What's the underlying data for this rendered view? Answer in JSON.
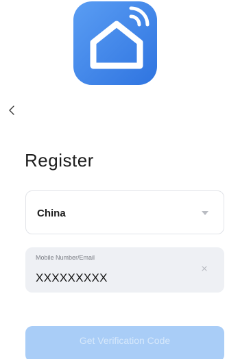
{
  "app": {
    "icon": "home-wifi-icon",
    "icon_color_start": "#5a9df3",
    "icon_color_end": "#2f74e0"
  },
  "nav": {
    "back_icon": "chevron-left-icon"
  },
  "page": {
    "title": "Register"
  },
  "country": {
    "selected": "China",
    "dropdown_icon": "caret-down-icon"
  },
  "account": {
    "label": "Mobile Number/Email",
    "value": "XXXXXXXXX",
    "clear_icon": "close-icon"
  },
  "actions": {
    "get_code_label": "Get Verification Code",
    "button_color": "#a9cdf7"
  }
}
